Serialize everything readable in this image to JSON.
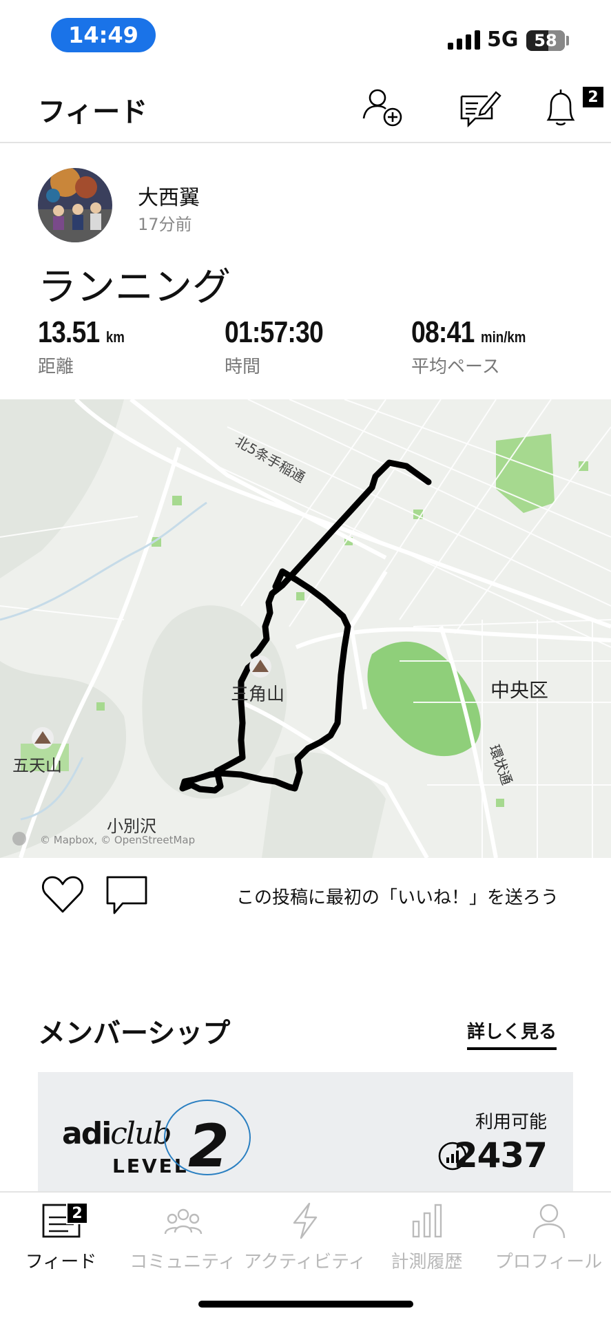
{
  "status_bar": {
    "time": "14:49",
    "network": "5G",
    "battery": "58"
  },
  "header": {
    "title": "フィード",
    "notification_count": "2"
  },
  "post": {
    "user_name": "大西翼",
    "posted_ago": "17分前",
    "activity_title": "ランニング",
    "stats": [
      {
        "value": "13.51",
        "unit": "km",
        "label": "距離"
      },
      {
        "value": "01:57:30",
        "unit": "",
        "label": "時間"
      },
      {
        "value": "08:41",
        "unit": "min/km",
        "label": "平均ペース"
      }
    ],
    "map": {
      "labels": {
        "street_north": "北5条手稲通",
        "district": "中央区",
        "mountain_1": "三角山",
        "mountain_2": "五天山",
        "area": "小別沢",
        "ring_road": "環状通"
      },
      "attribution": "© Mapbox, © OpenStreetMap",
      "route_color": "#000000",
      "park_color": "#8fcf7a",
      "land_color": "#eef0ec"
    },
    "like_prompt": "この投稿に最初の「いいね！」を送ろう"
  },
  "membership": {
    "section_title": "メンバーシップ",
    "see_more": "詳しく見る",
    "brand_left": "adi",
    "brand_right": "club",
    "level_text": "LEVEL",
    "level_number": "2",
    "available_label": "利用可能",
    "points": "2437"
  },
  "tabbar": {
    "active_tab": "フィード",
    "feed_badge": "2",
    "tabs": [
      {
        "label": "フィード",
        "icon": "feed-icon"
      },
      {
        "label": "コミュニティ",
        "icon": "community-icon"
      },
      {
        "label": "アクティビティ",
        "icon": "activity-icon"
      },
      {
        "label": "計測履歴",
        "icon": "history-icon"
      },
      {
        "label": "プロフィール",
        "icon": "profile-icon"
      }
    ]
  }
}
